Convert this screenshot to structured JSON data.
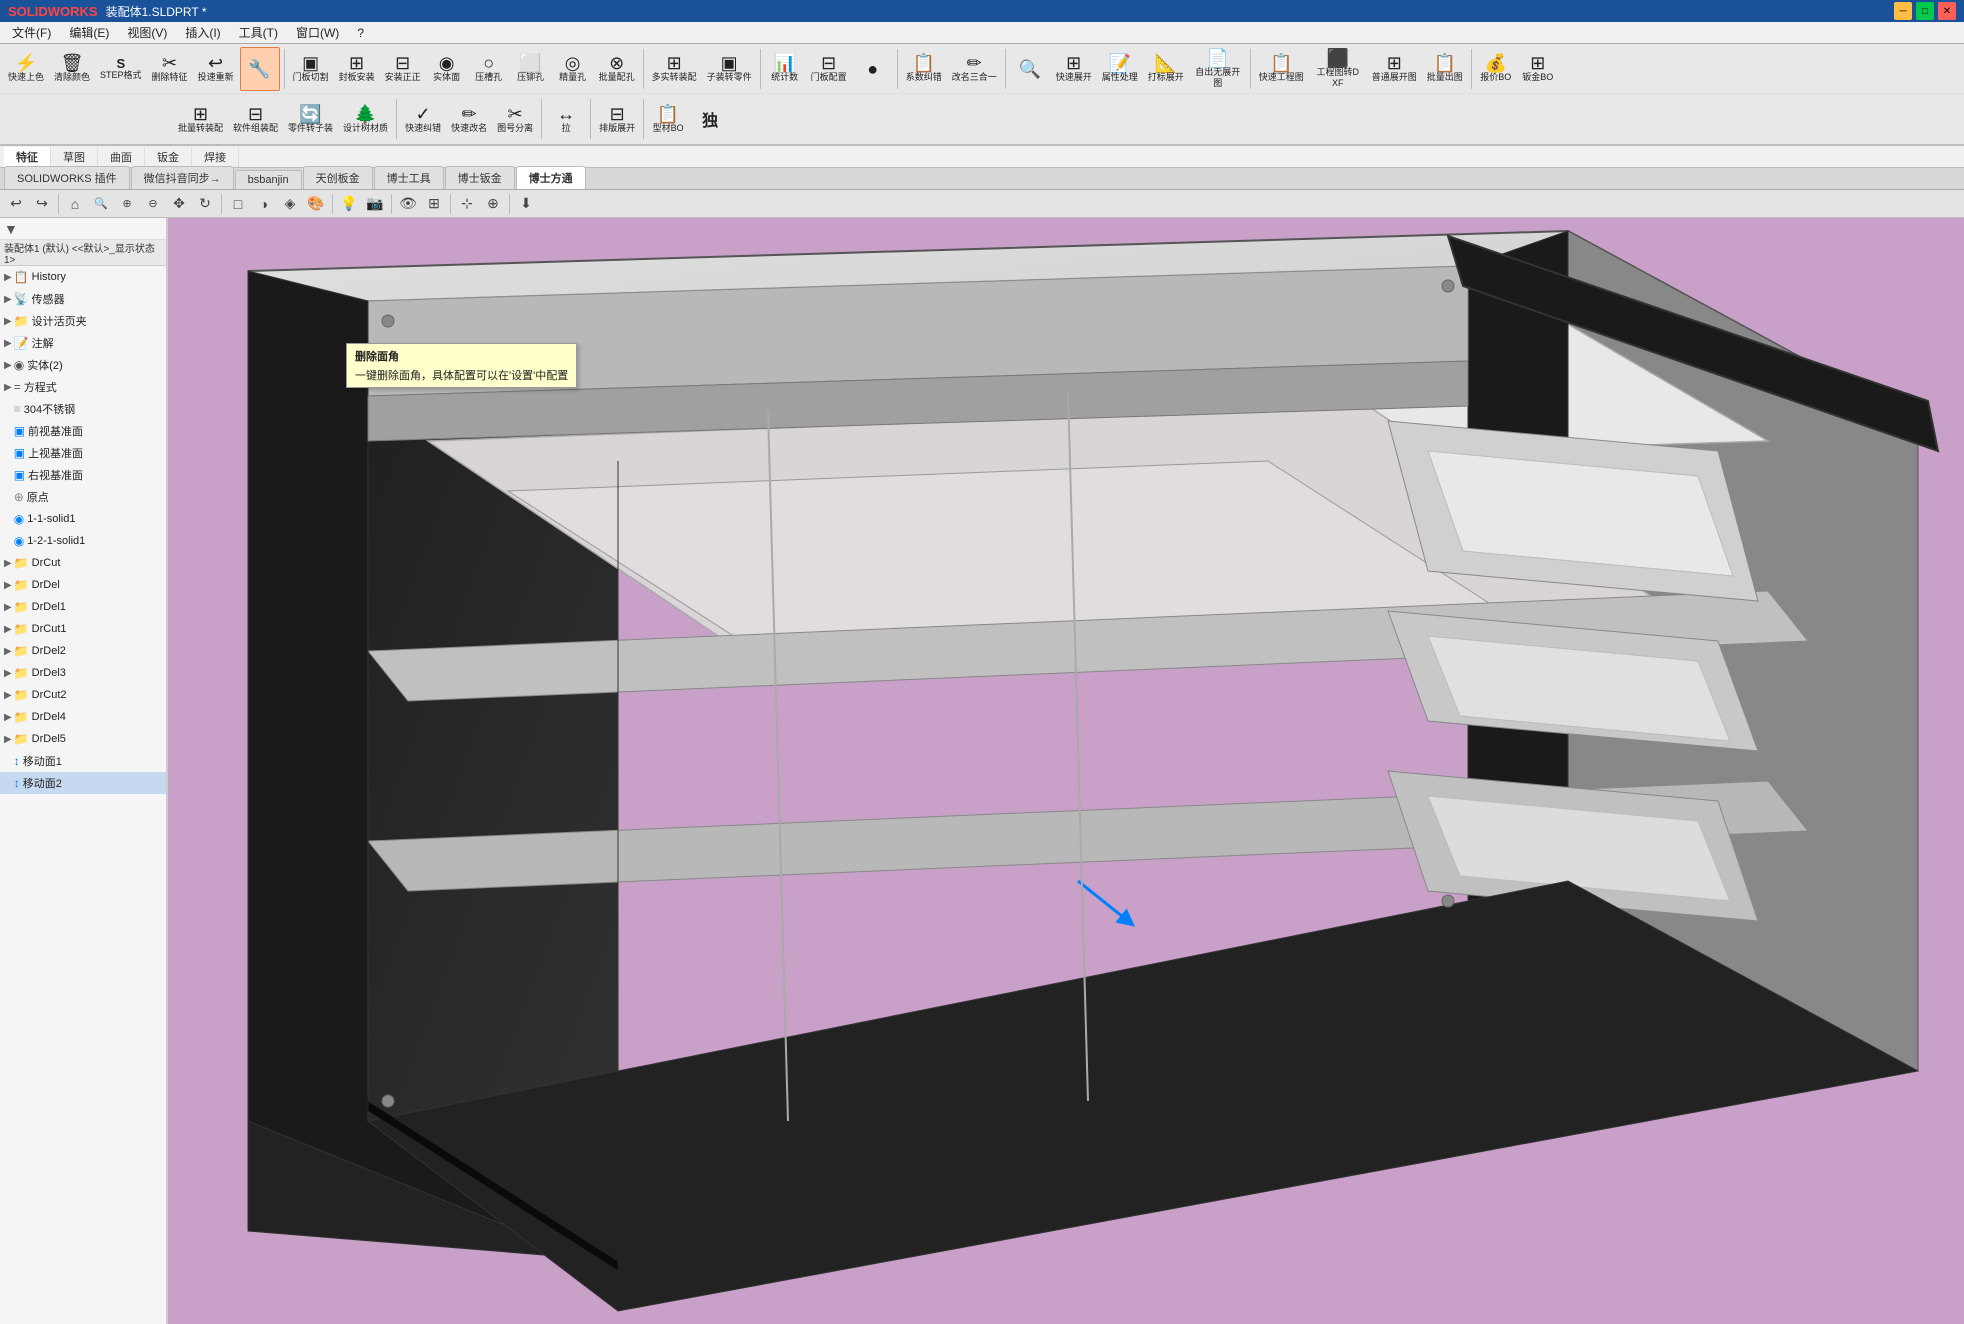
{
  "titleBar": {
    "logo": "SOLIDWORKS",
    "title": "装配体1.SLDPRT *",
    "minLabel": "─",
    "maxLabel": "□",
    "closeLabel": "✕"
  },
  "menuBar": {
    "items": [
      "文件(F)",
      "编辑(E)",
      "视图(V)",
      "插入(I)",
      "工具(T)",
      "窗口(W)",
      "?"
    ]
  },
  "toolbar": {
    "row1": [
      {
        "label": "快速上色",
        "icon": "⚡"
      },
      {
        "label": "清除颜色",
        "icon": "🧹"
      },
      {
        "label": "STEP格式",
        "icon": "S"
      },
      {
        "label": "删除特征",
        "icon": "✂"
      },
      {
        "label": "投速重新",
        "icon": "↩"
      },
      {
        "label": "",
        "icon": "🔧"
      },
      {
        "label": "门板切割",
        "icon": "▣"
      },
      {
        "label": "封板安装",
        "icon": "⊞"
      },
      {
        "label": "安装正正",
        "icon": "⊟"
      },
      {
        "label": "实体面",
        "icon": "◉"
      },
      {
        "label": "压槽孔",
        "icon": "○"
      },
      {
        "label": "压铆孔",
        "icon": "⬜"
      },
      {
        "label": "精量孔",
        "icon": "◎"
      },
      {
        "label": "批量配孔",
        "icon": "⊗"
      },
      {
        "label": "多实转装配",
        "icon": "⊞"
      },
      {
        "label": "子装转零件",
        "icon": "▣"
      },
      {
        "label": "",
        "icon": "━"
      },
      {
        "label": "统计数",
        "icon": "📊"
      },
      {
        "label": "门板配置",
        "icon": "⊟"
      },
      {
        "label": "",
        "icon": "●"
      },
      {
        "label": "系数纠错",
        "icon": "📋"
      },
      {
        "label": "改名三合一",
        "icon": "✏"
      },
      {
        "label": "",
        "icon": "🔍"
      },
      {
        "label": "快速展开",
        "icon": "⊞"
      },
      {
        "label": "属性处理",
        "icon": "📝"
      },
      {
        "label": "打标展开",
        "icon": "📐"
      },
      {
        "label": "自出无展开图",
        "icon": "📄"
      },
      {
        "label": "快速工程图",
        "icon": "📋"
      },
      {
        "label": "工程图转DXF",
        "icon": "⬛"
      },
      {
        "label": "普通展开图",
        "icon": "⊞"
      },
      {
        "label": "批量出图",
        "icon": "📋"
      },
      {
        "label": "报价BO",
        "icon": "💰"
      },
      {
        "label": "钣金BO",
        "icon": "⊞"
      }
    ],
    "row2": [
      {
        "label": "批量转装配",
        "icon": "⊞"
      },
      {
        "label": "软件组装配",
        "icon": "⊟"
      },
      {
        "label": "零件转子装",
        "icon": "🔄"
      },
      {
        "label": "设计树材质",
        "icon": "🌲"
      },
      {
        "label": "快速纠错",
        "icon": "✓"
      },
      {
        "label": "快速改名",
        "icon": "✏"
      },
      {
        "label": "图号分离",
        "icon": "✂"
      },
      {
        "label": "拉",
        "icon": "⊞"
      },
      {
        "label": "排版展开",
        "icon": "⊟"
      },
      {
        "label": "型材BO",
        "icon": "📋"
      }
    ]
  },
  "secondaryTabs": {
    "items": [
      "特征",
      "草图",
      "曲面",
      "钣金",
      "焊接"
    ],
    "activeIndex": 0
  },
  "pluginTabs": {
    "items": [
      "SOLIDWORKS 插件",
      "微信抖音同步→",
      "bsbanjin",
      "天创板金",
      "博士工具",
      "博士钣金",
      "博士方通"
    ],
    "activeIndex": 6
  },
  "viewToolbar": {
    "buttons": [
      "⤺",
      "⤻",
      "⊞",
      "🔍",
      "🔎",
      "🔍",
      "↔",
      "⊟",
      "⊞",
      "□",
      "◉",
      "△",
      "⊙",
      "⊟",
      "⊞",
      "⊞",
      "💡",
      "🎨",
      "⊞",
      "⊟",
      "⊞",
      "⊟",
      "⊞",
      "⊟",
      "⊞",
      "⬇"
    ]
  },
  "sidebar": {
    "title": "装配体1 (默认) <<默认>_显示状态 1>",
    "filterIcon": "▼",
    "items": [
      {
        "id": "history",
        "label": "History",
        "indent": 1,
        "icon": "📋",
        "expand": "▶",
        "type": "folder"
      },
      {
        "id": "sensor",
        "label": "传感器",
        "indent": 1,
        "icon": "📡",
        "expand": "▶",
        "type": "folder"
      },
      {
        "id": "design",
        "label": "设计活页夹",
        "indent": 1,
        "icon": "📁",
        "expand": "▶",
        "type": "folder"
      },
      {
        "id": "note",
        "label": "注解",
        "indent": 1,
        "icon": "📝",
        "expand": "▶",
        "type": "folder"
      },
      {
        "id": "solid",
        "label": "实体(2)",
        "indent": 1,
        "icon": "◉",
        "expand": "▶",
        "type": "folder"
      },
      {
        "id": "equation",
        "label": "方程式",
        "indent": 1,
        "icon": "=",
        "expand": "▶",
        "type": "folder"
      },
      {
        "id": "material",
        "label": "304不锈钢",
        "indent": 1,
        "icon": "⊞",
        "expand": "",
        "type": "item"
      },
      {
        "id": "front",
        "label": "前视基准面",
        "indent": 1,
        "icon": "▣",
        "expand": "",
        "type": "item"
      },
      {
        "id": "top",
        "label": "上视基准面",
        "indent": 1,
        "icon": "▣",
        "expand": "",
        "type": "item"
      },
      {
        "id": "right",
        "label": "右视基准面",
        "indent": 1,
        "icon": "▣",
        "expand": "",
        "type": "item"
      },
      {
        "id": "origin",
        "label": "原点",
        "indent": 1,
        "icon": "⊕",
        "expand": "",
        "type": "item"
      },
      {
        "id": "solid1",
        "label": "1-1-solid1",
        "indent": 1,
        "icon": "◉",
        "expand": "",
        "type": "item"
      },
      {
        "id": "solid2",
        "label": "1-2-1-solid1",
        "indent": 1,
        "icon": "◉",
        "expand": "",
        "type": "item"
      },
      {
        "id": "drcut",
        "label": "DrCut",
        "indent": 1,
        "icon": "📁",
        "expand": "▶",
        "type": "folder"
      },
      {
        "id": "drdel",
        "label": "DrDel",
        "indent": 1,
        "icon": "📁",
        "expand": "▶",
        "type": "folder"
      },
      {
        "id": "drdel1",
        "label": "DrDel1",
        "indent": 1,
        "icon": "📁",
        "expand": "▶",
        "type": "folder"
      },
      {
        "id": "drcut1",
        "label": "DrCut1",
        "indent": 1,
        "icon": "📁",
        "expand": "▶",
        "type": "folder"
      },
      {
        "id": "drdel2",
        "label": "DrDel2",
        "indent": 1,
        "icon": "📁",
        "expand": "▶",
        "type": "folder"
      },
      {
        "id": "drdel3",
        "label": "DrDel3",
        "indent": 1,
        "icon": "📁",
        "expand": "▶",
        "type": "folder"
      },
      {
        "id": "drcut2",
        "label": "DrCut2",
        "indent": 1,
        "icon": "📁",
        "expand": "▶",
        "type": "folder"
      },
      {
        "id": "drdel4",
        "label": "DrDel4",
        "indent": 1,
        "icon": "📁",
        "expand": "▶",
        "type": "folder"
      },
      {
        "id": "drdel5",
        "label": "DrDel5",
        "indent": 1,
        "icon": "📁",
        "expand": "▶",
        "type": "folder"
      },
      {
        "id": "move1",
        "label": "移动面1",
        "indent": 1,
        "icon": "↕",
        "expand": "",
        "type": "item"
      },
      {
        "id": "move2",
        "label": "移动面2",
        "indent": 1,
        "icon": "↕",
        "expand": "",
        "type": "item",
        "selected": true
      }
    ]
  },
  "tooltip": {
    "title": "删除面角",
    "description": "一键删除面角，具体配置可以在'设置'中配置"
  },
  "colors": {
    "background": "#c8a0c8",
    "viewport": "#c8a0c8",
    "frameLight": "#d0d0d0",
    "frameDark": "#202020",
    "frameMid": "#a0a0a0",
    "sidebarBg": "#f5f5f5",
    "toolbarBg": "#e8e8e8"
  }
}
